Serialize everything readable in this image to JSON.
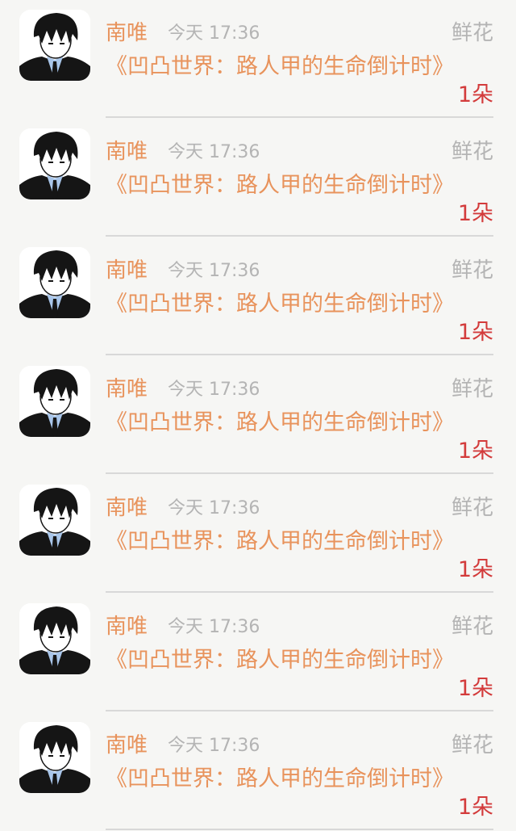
{
  "items": [
    {
      "name": "南唯",
      "time": "今天 17:36",
      "gift_type": "鲜花",
      "title": "《凹凸世界：路人甲的生命倒计时》",
      "count": "1朵"
    },
    {
      "name": "南唯",
      "time": "今天 17:36",
      "gift_type": "鲜花",
      "title": "《凹凸世界：路人甲的生命倒计时》",
      "count": "1朵"
    },
    {
      "name": "南唯",
      "time": "今天 17:36",
      "gift_type": "鲜花",
      "title": "《凹凸世界：路人甲的生命倒计时》",
      "count": "1朵"
    },
    {
      "name": "南唯",
      "time": "今天 17:36",
      "gift_type": "鲜花",
      "title": "《凹凸世界：路人甲的生命倒计时》",
      "count": "1朵"
    },
    {
      "name": "南唯",
      "time": "今天 17:36",
      "gift_type": "鲜花",
      "title": "《凹凸世界：路人甲的生命倒计时》",
      "count": "1朵"
    },
    {
      "name": "南唯",
      "time": "今天 17:36",
      "gift_type": "鲜花",
      "title": "《凹凸世界：路人甲的生命倒计时》",
      "count": "1朵"
    },
    {
      "name": "南唯",
      "time": "今天 17:36",
      "gift_type": "鲜花",
      "title": "《凹凸世界：路人甲的生命倒计时》",
      "count": "1朵"
    }
  ],
  "colors": {
    "accent_orange": "#e8935c",
    "count_red": "#d33b3b",
    "meta_gray": "#b4b4b4",
    "background": "#f6f6f4",
    "divider": "#d8d8d8"
  },
  "icons": {
    "avatar": "anime-boy-avatar-icon"
  }
}
